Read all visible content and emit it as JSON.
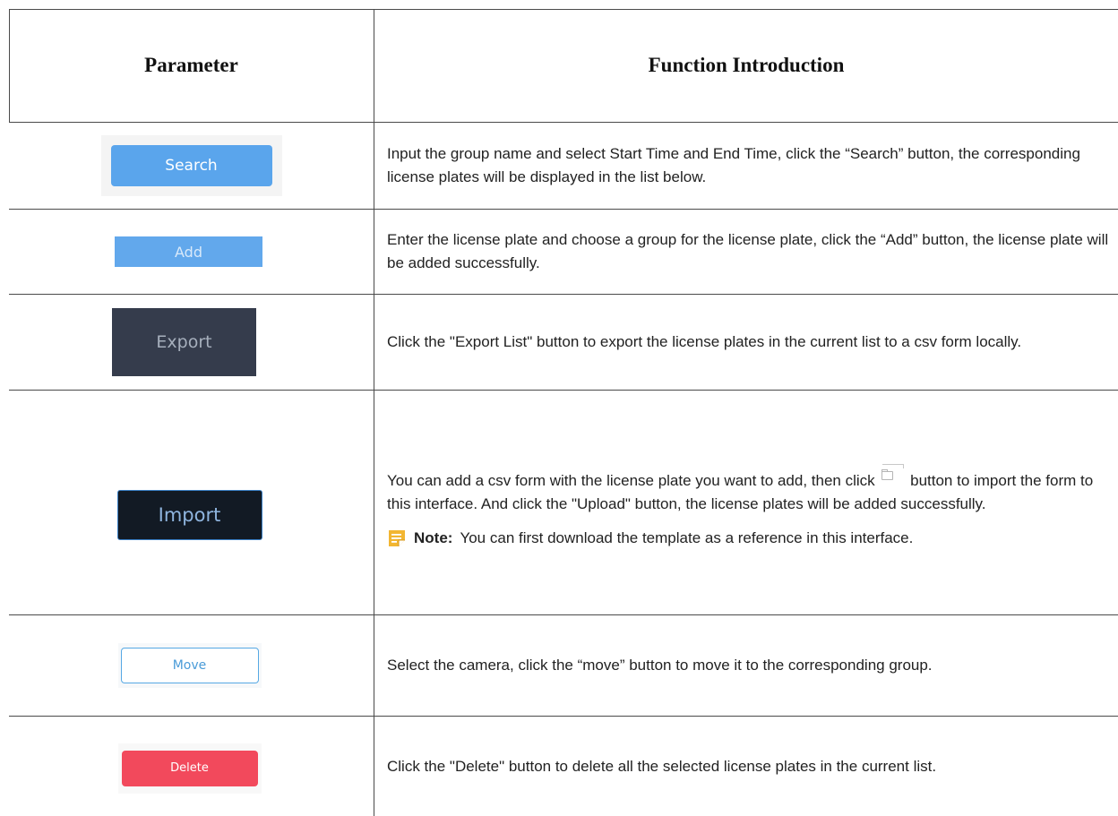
{
  "header": {
    "col1": "Parameter",
    "col2": "Function Introduction"
  },
  "rows": [
    {
      "button_label": "Search",
      "description": "Input the group name and select Start Time and End Time, click the “Search” button, the corresponding license plates will be displayed in the list below."
    },
    {
      "button_label": "Add",
      "description": "Enter the license plate and choose a group for the license plate, click the “Add” button, the license plate will be added successfully."
    },
    {
      "button_label": "Export",
      "description": "Click the \"Export List\" button to export the license plates in the current list to a csv form locally."
    },
    {
      "button_label": "Import",
      "description_part1": "You can add a csv form with the license plate you want to add, then click",
      "description_part2": "button to import the form to this interface. And click the \"Upload\" button, the license plates will be added successfully.",
      "inline_icon": "folder-upload-icon",
      "note_label": "Note:",
      "note_text": "You can first download the template as a reference in this interface.",
      "note_icon": "note-icon"
    },
    {
      "button_label": "Move",
      "description": "Select the camera, click the “move” button to move it to the corresponding group."
    },
    {
      "button_label": "Delete",
      "description": "Click the \"Delete\" button to delete all the selected license plates in the current list."
    }
  ],
  "colors": {
    "search_button": "#5aa5ec",
    "add_button": "#62a8ec",
    "export_button": "#353c4c",
    "import_button": "#121a24",
    "import_border": "#3a7fc4",
    "move_border": "#56a8e4",
    "move_text": "#4a9bd8",
    "delete_button": "#f2495c",
    "note_icon": "#f2b632"
  }
}
